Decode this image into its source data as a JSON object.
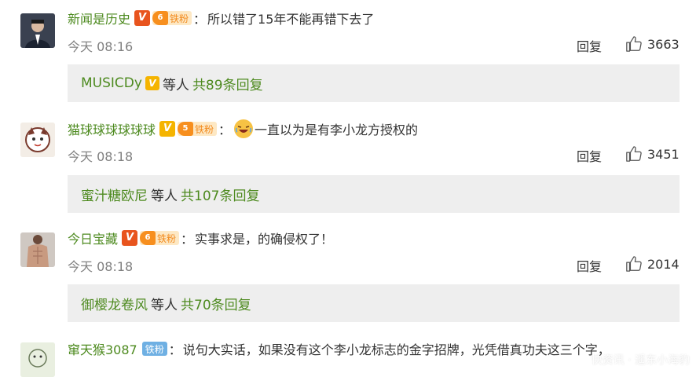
{
  "comments": [
    {
      "username": "新闻是历史",
      "v_badge": "V",
      "fan_level": "6",
      "fan_label": "铁粉",
      "colon": "：",
      "text": "所以错了15年不能再错下去了",
      "time": "今天 08:16",
      "reply_label": "回复",
      "likes": "3663",
      "sub": {
        "name": "MUSICDy",
        "v_badge": "V",
        "etc": "等人",
        "total": "共89条回复"
      }
    },
    {
      "username": "猫球球球球球球",
      "v_badge": "V",
      "fan_level": "5",
      "fan_label": "铁粉",
      "colon": "：",
      "text": "一直以为是有李小龙方授权的",
      "time": "今天 08:18",
      "reply_label": "回复",
      "likes": "3451",
      "sub": {
        "name": "蜜汁糖欧尼",
        "etc": "等人",
        "total": "共107条回复"
      }
    },
    {
      "username": "今日宝藏",
      "v_badge": "V",
      "fan_level": "6",
      "fan_label": "铁粉",
      "colon": "：",
      "text": "实事求是，的确侵权了！",
      "time": "今天 08:18",
      "reply_label": "回复",
      "likes": "2014",
      "sub": {
        "name": "御樱龙卷风",
        "etc": "等人",
        "total": "共70条回复"
      }
    },
    {
      "username": "窜天猴3087",
      "fan_label": "铁粉",
      "colon": "：",
      "text": "说句大实话，如果没有这个李小龙标志的金字招牌，光凭借真功夫这三个字，"
    }
  ],
  "watermark": "快资讯 · 遥东小海豹",
  "colors": {
    "username": "#4d8a1f",
    "sub_bg": "#eeeeee",
    "badge_red": "#e8541e",
    "badge_gold": "#f5b400",
    "fan_orange": "#f78f1e",
    "fan_blue": "#6fb0e3"
  }
}
